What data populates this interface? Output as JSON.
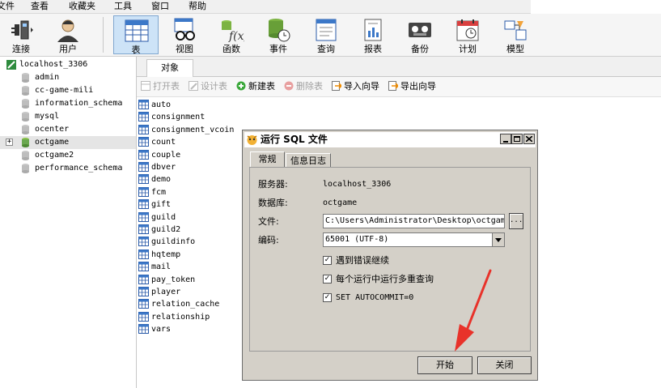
{
  "menu": [
    "文件",
    "查看",
    "收藏夹",
    "工具",
    "窗口",
    "帮助"
  ],
  "toolbar": {
    "items": [
      {
        "label": "连接",
        "icon": "plug-connect-icon"
      },
      {
        "label": "用户",
        "icon": "user-icon"
      },
      {
        "label": "表",
        "icon": "table-icon",
        "active": true
      },
      {
        "label": "视图",
        "icon": "view-glasses-icon"
      },
      {
        "label": "函数",
        "icon": "function-icon"
      },
      {
        "label": "事件",
        "icon": "event-clock-icon"
      },
      {
        "label": "查询",
        "icon": "query-icon"
      },
      {
        "label": "报表",
        "icon": "report-icon"
      },
      {
        "label": "备份",
        "icon": "backup-tape-icon"
      },
      {
        "label": "计划",
        "icon": "calendar-icon"
      },
      {
        "label": "模型",
        "icon": "model-icon"
      }
    ]
  },
  "tree": {
    "connection": "localhost_3306",
    "databases": [
      "admin",
      "cc-game-mili",
      "information_schema",
      "mysql",
      "ocenter",
      "octgame",
      "octgame2",
      "performance_schema"
    ],
    "selected": "octgame",
    "expander": "+"
  },
  "tabs": {
    "objects": "对象"
  },
  "object_toolbar": {
    "open_table": "打开表",
    "design_table": "设计表",
    "new_table": "新建表",
    "delete_table": "删除表",
    "import_wizard": "导入向导",
    "export_wizard": "导出向导"
  },
  "tables": [
    "auto",
    "consignment",
    "consignment_vcoin",
    "count",
    "couple",
    "dbver",
    "demo",
    "fcm",
    "gift",
    "guild",
    "guild2",
    "guildinfo",
    "hqtemp",
    "mail",
    "pay_token",
    "player",
    "relation_cache",
    "relationship",
    "vars"
  ],
  "dialog": {
    "title": "运行 SQL 文件",
    "tabs": [
      "常规",
      "信息日志"
    ],
    "server_label": "服务器:",
    "server_value": "localhost_3306",
    "database_label": "数据库:",
    "database_value": "octgame",
    "file_label": "文件:",
    "file_value": "C:\\Users\\Administrator\\Desktop\\octgame.sq",
    "browse_label": "...",
    "encoding_label": "编码:",
    "encoding_value": "65001 (UTF-8)",
    "options": [
      {
        "label": "遇到错误继续",
        "checked": true
      },
      {
        "label": "每个运行中运行多重查询",
        "checked": true
      },
      {
        "label": "SET AUTOCOMMIT=0",
        "checked": true
      }
    ],
    "start_button": "开始",
    "close_button": "关闭"
  },
  "colors": {
    "annotation_arrow": "#e8322a",
    "selection": "#e5e5e5",
    "active_tool": "#cde3f7"
  }
}
